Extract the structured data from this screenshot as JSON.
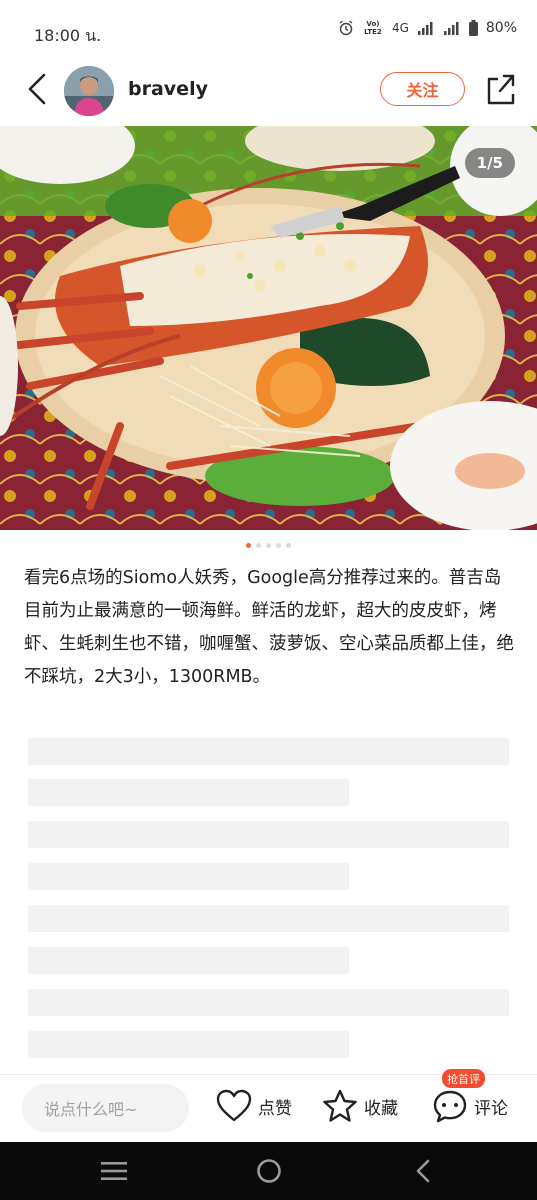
{
  "status_bar": {
    "time": "18:00 น.",
    "network_top": "Vo) LTE2",
    "network": "4G",
    "battery": "80%"
  },
  "header": {
    "username": "bravely",
    "follow_label": "关注"
  },
  "photo": {
    "counter": "1/5",
    "total": 5,
    "current": 1
  },
  "post": {
    "text": "看完6点场的Siomo人妖秀，Google高分推荐过来的。普吉岛目前为止最满意的一顿海鲜。鲜活的龙虾，超大的皮皮虾，烤虾、生蚝刺生也不错，咖喱蟹、菠萝饭、空心菜品质都上佳，绝不踩坑，2大3小，1300RMB。"
  },
  "bottom_bar": {
    "input_placeholder": "说点什么吧~",
    "like_label": "点赞",
    "collect_label": "收藏",
    "comment_label": "评论",
    "comment_badge": "抢首评"
  },
  "colors": {
    "accent": "#f0643c",
    "badge": "#f24b2d",
    "skeleton": "#f2f2f2",
    "nav_bg": "#0a0a0a"
  },
  "icons": [
    "alarm-icon",
    "signal-icon",
    "battery-icon",
    "back-icon",
    "share-icon",
    "heart-icon",
    "star-icon",
    "comment-bubble-icon",
    "menu-icon",
    "home-icon",
    "back-triangle-icon"
  ]
}
